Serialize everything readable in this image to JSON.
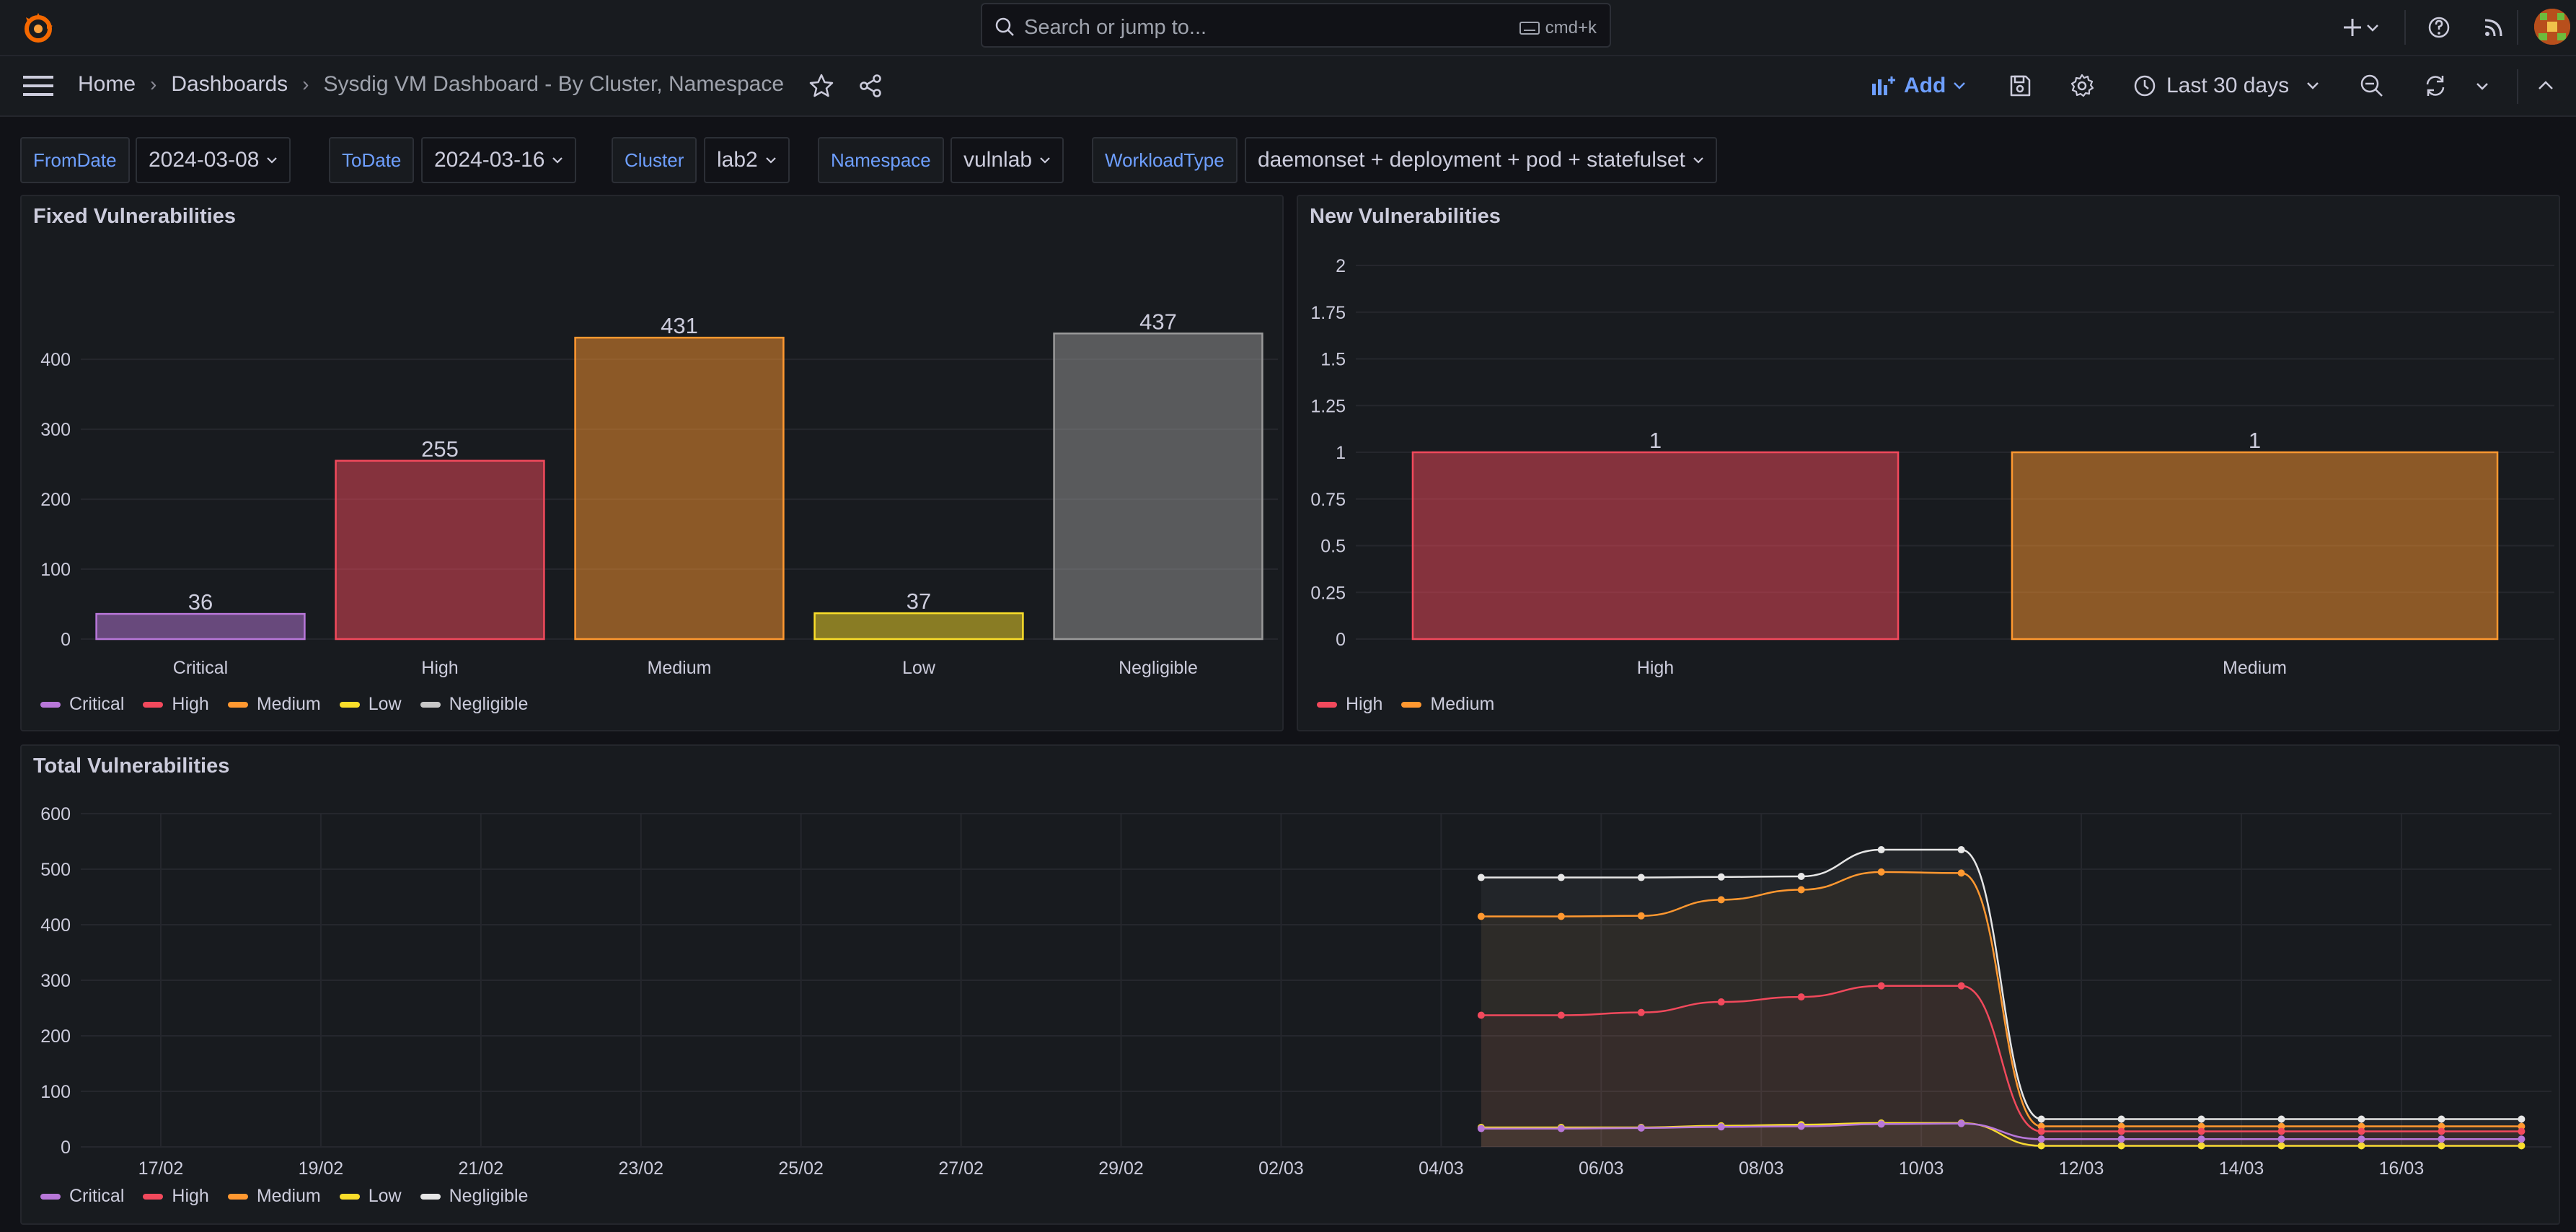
{
  "search": {
    "placeholder": "Search or jump to...",
    "shortcut": "cmd+k"
  },
  "breadcrumb": {
    "home": "Home",
    "dashboards": "Dashboards",
    "current": "Sysdig VM Dashboard - By Cluster, Namespace"
  },
  "toolbar": {
    "add_label": "Add",
    "time_range": "Last 30 days"
  },
  "variables": [
    {
      "label": "FromDate",
      "value": "2024-03-08"
    },
    {
      "label": "ToDate",
      "value": "2024-03-16"
    },
    {
      "label": "Cluster",
      "value": "lab2"
    },
    {
      "label": "Namespace",
      "value": "vulnlab"
    },
    {
      "label": "WorkloadType",
      "value": "daemonset + deployment + pod + statefulset"
    }
  ],
  "colors": {
    "Critical": "#b877d9",
    "High": "#f2495c",
    "Medium": "#ff9830",
    "Low": "#fade2a",
    "Negligible": "#c7c7c7",
    "Negligible_bar": "#9a9a9a",
    "Total_line": "#e6e6e6"
  },
  "panels": {
    "fixed": {
      "title": "Fixed Vulnerabilities"
    },
    "new": {
      "title": "New Vulnerabilities"
    },
    "total": {
      "title": "Total Vulnerabilities"
    }
  },
  "legends": {
    "fixed": [
      "Critical",
      "High",
      "Medium",
      "Low",
      "Negligible"
    ],
    "new": [
      "High",
      "Medium"
    ],
    "total": [
      "Critical",
      "High",
      "Medium",
      "Low",
      "Negligible"
    ]
  },
  "chart_data": [
    {
      "id": "fixed",
      "type": "bar",
      "title": "Fixed Vulnerabilities",
      "categories": [
        "Critical",
        "High",
        "Medium",
        "Low",
        "Negligible"
      ],
      "values": [
        36,
        255,
        431,
        37,
        437
      ],
      "yticks": [
        0,
        100,
        200,
        300,
        400
      ],
      "ylim": [
        0,
        460
      ],
      "grid": true,
      "legend": "bottom-left"
    },
    {
      "id": "new",
      "type": "bar",
      "title": "New Vulnerabilities",
      "categories": [
        "High",
        "Medium"
      ],
      "values": [
        1,
        1
      ],
      "yticks": [
        "0",
        "0.25",
        "0.5",
        "0.75",
        "1",
        "1.25",
        "1.5",
        "1.75",
        "2"
      ],
      "ylim": [
        0,
        2
      ],
      "grid": true,
      "legend": "bottom-left"
    },
    {
      "id": "total",
      "type": "line",
      "title": "Total Vulnerabilities",
      "xticks": [
        "17/02",
        "19/02",
        "21/02",
        "23/02",
        "25/02",
        "27/02",
        "29/02",
        "02/03",
        "04/03",
        "06/03",
        "08/03",
        "10/03",
        "12/03",
        "14/03",
        "16/03"
      ],
      "yticks": [
        0,
        100,
        200,
        300,
        400,
        500,
        600
      ],
      "ylim": [
        0,
        600
      ],
      "x": [
        "2024-03-04 12:00",
        "2024-03-05 12:00",
        "2024-03-06 12:00",
        "2024-03-07 12:00",
        "2024-03-08 12:00",
        "2024-03-09 12:00",
        "2024-03-10 12:00",
        "2024-03-11 12:00",
        "2024-03-12 12:00",
        "2024-03-13 12:00",
        "2024-03-14 12:00",
        "2024-03-15 12:00",
        "2024-03-16 12:00",
        "2024-03-17 12:00"
      ],
      "series": [
        {
          "name": "Negligible",
          "values": [
            485,
            485,
            485,
            486,
            487,
            535,
            535,
            50,
            50,
            50,
            50,
            50,
            50,
            50
          ]
        },
        {
          "name": "Medium",
          "values": [
            415,
            415,
            416,
            445,
            463,
            495,
            493,
            37,
            37,
            37,
            37,
            37,
            37,
            37
          ]
        },
        {
          "name": "High",
          "values": [
            237,
            237,
            242,
            261,
            270,
            290,
            290,
            28,
            28,
            28,
            28,
            28,
            28,
            28
          ]
        },
        {
          "name": "Low",
          "values": [
            35,
            35,
            35,
            38,
            40,
            43,
            43,
            2,
            2,
            2,
            2,
            2,
            2,
            2
          ]
        },
        {
          "name": "Critical",
          "values": [
            33,
            33,
            34,
            36,
            37,
            41,
            42,
            14,
            14,
            14,
            14,
            14,
            14,
            14
          ]
        }
      ],
      "grid": true,
      "legend": "bottom-left"
    }
  ]
}
